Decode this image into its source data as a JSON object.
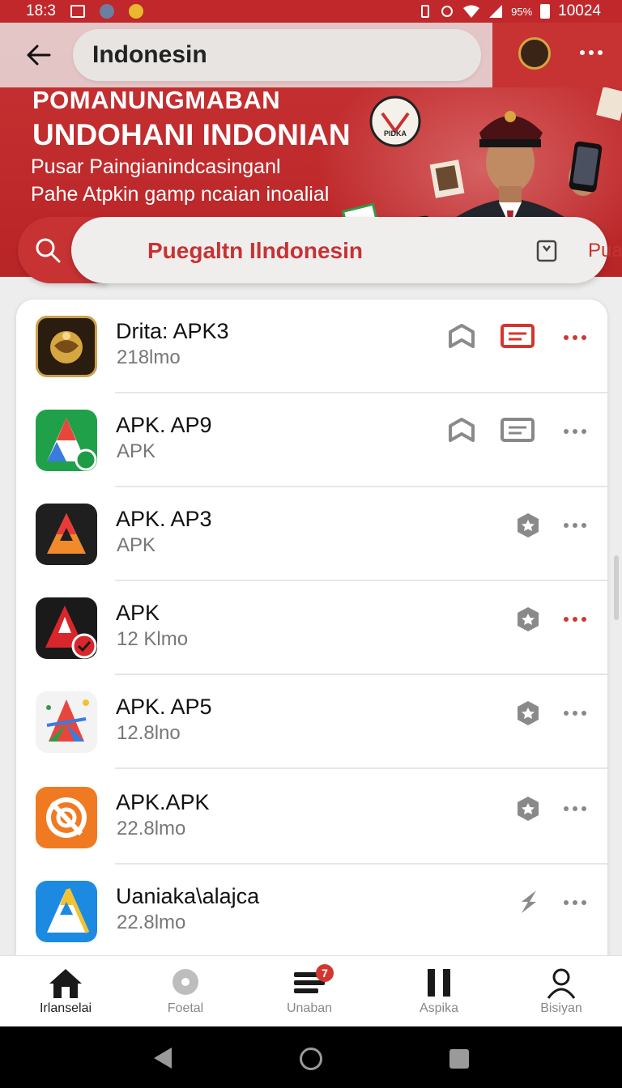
{
  "status_bar": {
    "time": "18:3",
    "battery": "95%",
    "clock_right": "10024"
  },
  "app_bar": {
    "title": "Indonesin"
  },
  "hero": {
    "title1": "POMANUNGMABAN",
    "title2": "UNDOHANI INDONIAN",
    "subtitle1": "Pusar Paingianindcasinganl",
    "subtitle2": "Pahe Atpkin gamp ncaian inoalial",
    "badge_text": "PIDKA"
  },
  "search": {
    "value": "Puegaltn Ilndonesin",
    "action_label": "Pualk"
  },
  "apps": [
    {
      "name": "Drita: APK3",
      "meta": "218lmo",
      "actions": [
        "shield-icon",
        "message-icon"
      ],
      "dots_color": "red"
    },
    {
      "name": "APK. AP9",
      "meta": "APK",
      "actions": [
        "shield-icon",
        "message-icon"
      ],
      "dots_color": "grey"
    },
    {
      "name": "APK. AP3",
      "meta": "APK",
      "actions": [
        "hex-star-icon"
      ],
      "dots_color": "grey"
    },
    {
      "name": "APK",
      "meta": "12 Klmo",
      "actions": [
        "hex-star-icon"
      ],
      "dots_color": "red"
    },
    {
      "name": "APK. AP5",
      "meta": "12.8lno",
      "actions": [
        "hex-star-icon"
      ],
      "dots_color": "grey"
    },
    {
      "name": "APK.APK",
      "meta": "22.8lmo",
      "actions": [
        "hex-star-icon"
      ],
      "dots_color": "grey"
    },
    {
      "name": "Uaniaka\\alajca",
      "meta": "22.8lmo",
      "actions": [
        "arrow-icon"
      ],
      "dots_color": "grey"
    }
  ],
  "bottom_nav": [
    {
      "label": "Irlanselai",
      "icon": "home-icon",
      "active": true
    },
    {
      "label": "Foetal",
      "icon": "disc-icon",
      "active": false
    },
    {
      "label": "Unaban",
      "icon": "list-icon",
      "active": false,
      "badge": "7"
    },
    {
      "label": "Aspika",
      "icon": "pause-icon",
      "active": false
    },
    {
      "label": "Bisiyan",
      "icon": "person-icon",
      "active": false
    }
  ],
  "colors": {
    "accent": "#c73233",
    "dots_red": "#d2372f"
  }
}
